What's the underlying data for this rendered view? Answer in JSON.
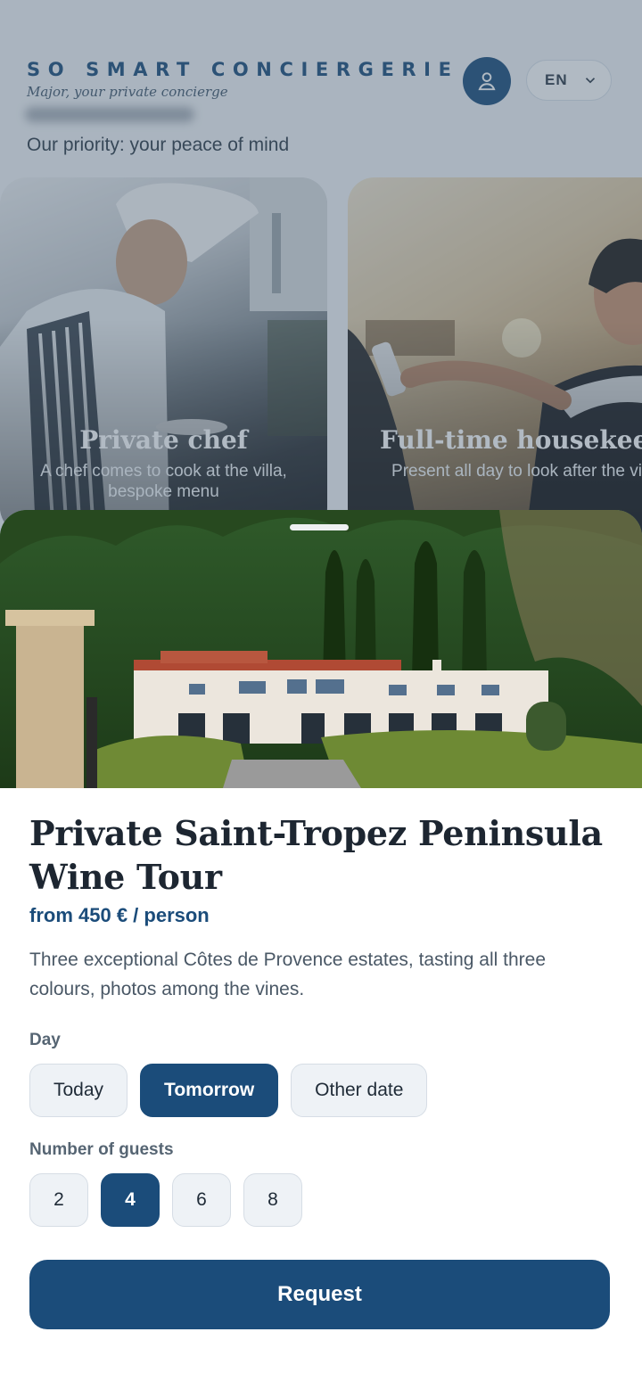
{
  "header": {
    "brand": "SO SMART CONCIERGERIE",
    "tagline": "Major, your private concierge",
    "language": "EN"
  },
  "intro": "Our priority: your peace of mind",
  "services": [
    {
      "title": "Private chef",
      "description": "A chef comes to cook at the villa, bespoke menu"
    },
    {
      "title": "Full-time housekeeper",
      "description": "Present all day to look after the villa"
    }
  ],
  "sheet": {
    "title": "Private Saint-Tropez Peninsula Wine Tour",
    "price": "from 450 € / person",
    "description": "Three exceptional Côtes de Provence estates, tasting all three colours, photos among the vines.",
    "day_label": "Day",
    "day_options": [
      "Today",
      "Tomorrow",
      "Other date"
    ],
    "selected_day": "Tomorrow",
    "guests_label": "Number of guests",
    "guest_options": [
      "2",
      "4",
      "6",
      "8"
    ],
    "selected_guests": "4",
    "request_label": "Request"
  },
  "colors": {
    "brand": "#1b4c7a",
    "chip_bg": "#eef2f6",
    "text": "#1d2631"
  },
  "icons": [
    "user-icon",
    "chevron-down-icon"
  ]
}
